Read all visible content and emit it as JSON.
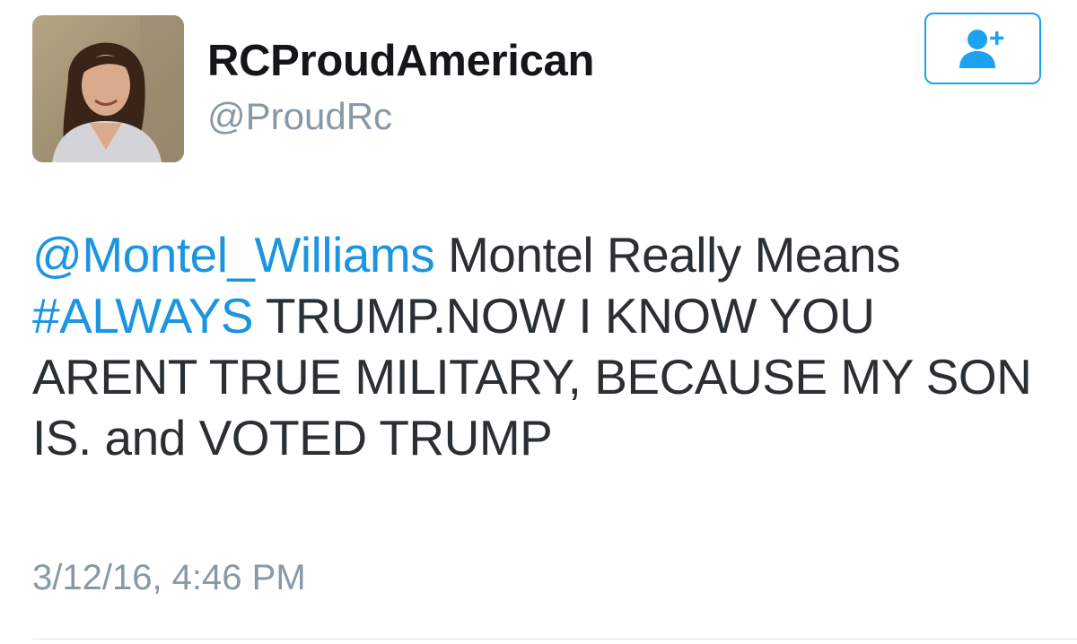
{
  "user": {
    "display_name": "RCProudAmerican",
    "handle": "@ProudRc",
    "avatar_icon": "profile-photo"
  },
  "follow_button": {
    "icon": "add-user-icon",
    "color": "#1da1f2"
  },
  "tweet": {
    "mention": "@Montel_Williams",
    "text_part1": " Montel Really Means ",
    "hashtag": "#ALWAYS",
    "text_part2": " TRUMP.NOW I KNOW YOU ARENT TRUE MILITARY, BECAUSE MY SON IS. and VOTED TRUMP",
    "timestamp": "3/12/16, 4:46 PM"
  },
  "colors": {
    "link": "#1b95e0",
    "text": "#292f33",
    "secondary": "#8899a6"
  }
}
